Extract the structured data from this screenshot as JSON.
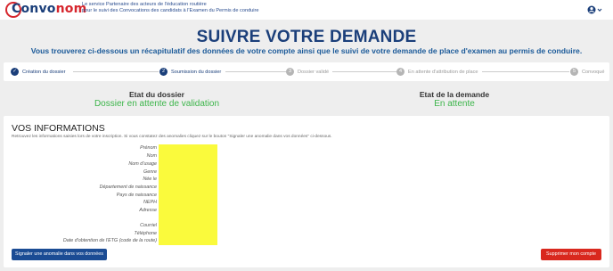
{
  "header": {
    "logo_part1": "Convo",
    "logo_part2": "nom",
    "tagline_line1": "Le service Partenaire des acteurs de l'éducation routière",
    "tagline_line2": "pour le suivi des Convocations des candidats à l'Examen du Permis de conduire",
    "user_menu_icon": "user-icon"
  },
  "page": {
    "title": "SUIVRE VOTRE DEMANDE",
    "subtitle": "Vous trouverez ci-dessous un récapitulatif des données de votre compte ainsi que le suivi de votre demande de place d'examen au permis de conduire."
  },
  "steps": [
    {
      "num": "✓",
      "label": "Création du dossier",
      "state": "done"
    },
    {
      "num": "2",
      "label": "Soumission du dossier",
      "state": "current"
    },
    {
      "num": "3",
      "label": "Dossier validé",
      "state": "todo"
    },
    {
      "num": "4",
      "label": "En attente d'attribution de place",
      "state": "todo"
    },
    {
      "num": "5",
      "label": "Convoqué",
      "state": "todo"
    }
  ],
  "status": {
    "dossier_heading": "Etat du dossier",
    "dossier_value": "Dossier en attente de validation",
    "demande_heading": "Etat de la demande",
    "demande_value": "En attente",
    "value_color": "#3cb54a"
  },
  "infos": {
    "title": "VOS INFORMATIONS",
    "subtitle": "Retrouvez les informations saisies lors de votre inscription. Si vous constatez des anomalies cliquez sur le bouton \"Signaler une anomalie dans vos données\" ci-dessous.",
    "fields": [
      "Prénom",
      "Nom",
      "Nom d'usage",
      "Genre",
      "Née le",
      "Département de naissance",
      "Pays de naissance",
      "NEPH",
      "Adresse",
      "",
      "Courriel",
      "Téléphone",
      "Date d'obtention de l'ETG (code de la route)"
    ],
    "report_button": "Signaler une anomalie dans vos données",
    "delete_button": "Supprimer mon compte"
  }
}
